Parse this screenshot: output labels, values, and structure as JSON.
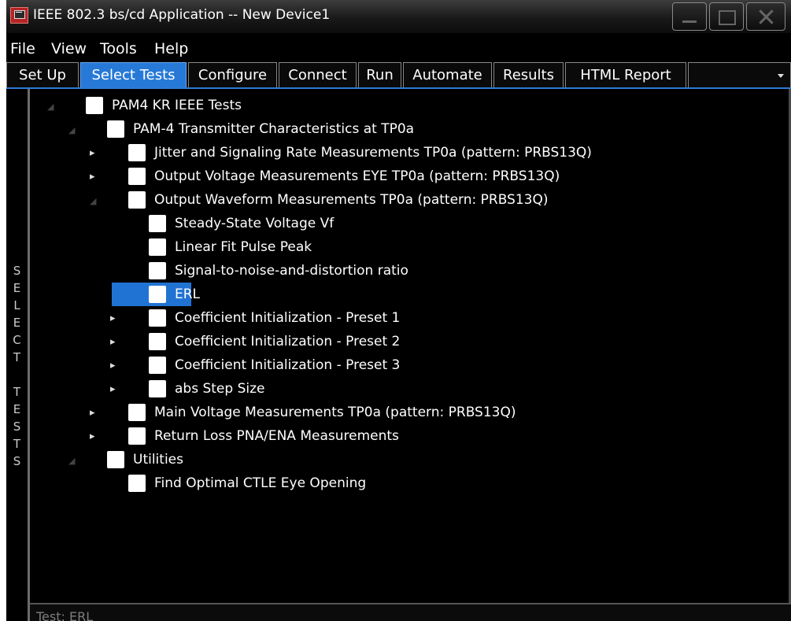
{
  "window": {
    "title": "IEEE 802.3 bs/cd Application -- New Device1",
    "app_icon": "oscilloscope-app-icon"
  },
  "menu": [
    "File",
    "View",
    "Tools",
    "Help"
  ],
  "tabs": [
    {
      "label": "Set Up",
      "active": false
    },
    {
      "label": "Select Tests",
      "active": true
    },
    {
      "label": "Configure",
      "active": false
    },
    {
      "label": "Connect",
      "active": false
    },
    {
      "label": "Run",
      "active": false
    },
    {
      "label": "Automate",
      "active": false
    },
    {
      "label": "Results",
      "active": false
    },
    {
      "label": "HTML Report",
      "active": false
    }
  ],
  "side_panel": {
    "label": "SELECT TESTS"
  },
  "tree": [
    {
      "label": "PAM4 KR IEEE Tests",
      "level": 0,
      "expander": "expanded",
      "checked": false,
      "selected": false
    },
    {
      "label": "PAM-4 Transmitter Characteristics at TP0a",
      "level": 1,
      "expander": "expanded",
      "checked": false,
      "selected": false
    },
    {
      "label": "Jitter and Signaling Rate Measurements TP0a (pattern: PRBS13Q)",
      "level": 2,
      "expander": "collapsed",
      "checked": false,
      "selected": false
    },
    {
      "label": "Output Voltage Measurements EYE TP0a (pattern: PRBS13Q)",
      "level": 2,
      "expander": "collapsed",
      "checked": false,
      "selected": false
    },
    {
      "label": "Output Waveform Measurements TP0a (pattern: PRBS13Q)",
      "level": 2,
      "expander": "expanded",
      "checked": false,
      "selected": false
    },
    {
      "label": "Steady-State Voltage Vf",
      "level": 3,
      "expander": "none",
      "checked": false,
      "selected": false
    },
    {
      "label": "Linear Fit Pulse Peak",
      "level": 3,
      "expander": "none",
      "checked": false,
      "selected": false
    },
    {
      "label": "Signal-to-noise-and-distortion ratio",
      "level": 3,
      "expander": "none",
      "checked": false,
      "selected": false
    },
    {
      "label": "ERL",
      "level": 3,
      "expander": "none",
      "checked": false,
      "selected": true
    },
    {
      "label": "Coefficient Initialization - Preset 1",
      "level": 3,
      "expander": "collapsed",
      "checked": false,
      "selected": false
    },
    {
      "label": "Coefficient Initialization - Preset 2",
      "level": 3,
      "expander": "collapsed",
      "checked": false,
      "selected": false
    },
    {
      "label": "Coefficient Initialization - Preset 3",
      "level": 3,
      "expander": "collapsed",
      "checked": false,
      "selected": false
    },
    {
      "label": "abs Step Size",
      "level": 3,
      "expander": "collapsed",
      "checked": false,
      "selected": false
    },
    {
      "label": "Main Voltage Measurements TP0a (pattern: PRBS13Q)",
      "level": 2,
      "expander": "collapsed",
      "checked": false,
      "selected": false
    },
    {
      "label": "Return Loss PNA/ENA Measurements",
      "level": 2,
      "expander": "collapsed",
      "checked": false,
      "selected": false
    },
    {
      "label": "Utilities",
      "level": 1,
      "expander": "expanded",
      "checked": false,
      "selected": false
    },
    {
      "label": "Find Optimal CTLE Eye Opening",
      "level": 2,
      "expander": "none",
      "checked": false,
      "selected": false
    }
  ],
  "status": {
    "text": "Test: ERL"
  },
  "colors": {
    "accent": "#2679d6",
    "selection": "#2173d3",
    "background": "#000000"
  }
}
